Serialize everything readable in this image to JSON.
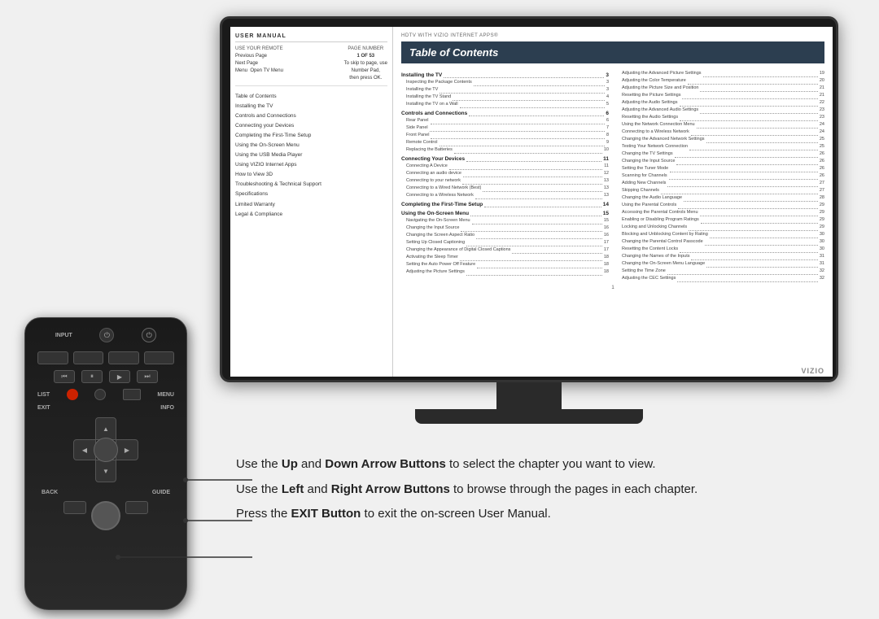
{
  "tv": {
    "brand": "VIZIO",
    "header_right": "HDTV WITH VIZIO INTERNET APPS®"
  },
  "manual": {
    "title": "USER MANUAL",
    "nav": {
      "col1_header": "USE YOUR REMOTE",
      "col2_header": "PAGE NUMBER",
      "rows": [
        {
          "action": "Previous Page",
          "detail": "1 OF 53"
        },
        {
          "action": "Next Page",
          "detail": "To skip to page, use"
        },
        {
          "action": "Menu  Open TV Menu",
          "detail": "Number Pad,"
        },
        {
          "action": "",
          "detail": "then press OK."
        }
      ],
      "page_display": "1 OF 53"
    },
    "toc_items": [
      "Table of Contents",
      "Installing the TV",
      "Controls and Connections",
      "Connecting your Devices",
      "Completing the First-Time Setup",
      "Using the On-Screen Menu",
      "Using the USB Media Player",
      "Using VIZIO Internet Apps",
      "How to View 3D",
      "Troubleshooting & Technical Support",
      "Specifications",
      "Limited Warranty",
      "Legal & Compliance"
    ],
    "toc_title": "Table of Contents",
    "toc_left_col": [
      {
        "title": "Installing the TV",
        "page": "3",
        "sub": [
          {
            "name": "Inspecting the Package Contents",
            "page": "3"
          },
          {
            "name": "Installing the TV",
            "page": "3"
          },
          {
            "name": "Installing the TV Stand",
            "page": "4"
          },
          {
            "name": "Installing the TV on a Wall",
            "page": "5"
          }
        ]
      },
      {
        "title": "Controls and Connections",
        "page": "6",
        "sub": [
          {
            "name": "Rear Panel",
            "page": "6"
          },
          {
            "name": "Side Panel",
            "page": "7"
          },
          {
            "name": "Front Panel",
            "page": "8"
          },
          {
            "name": "Remote Control",
            "page": "9"
          },
          {
            "name": "Replacing the Batteries",
            "page": "10"
          }
        ]
      },
      {
        "title": "Connecting Your Devices",
        "page": "11",
        "sub": [
          {
            "name": "Connecting A Device",
            "page": "11"
          },
          {
            "name": "Connecting an audio device",
            "page": "12"
          },
          {
            "name": "Connecting to your network",
            "page": "13"
          },
          {
            "name": "Connecting to a Wired Network (Best)",
            "page": "13"
          },
          {
            "name": "Connecting to a Wireless Network",
            "page": "13"
          }
        ]
      },
      {
        "title": "Completing the First-Time Setup",
        "page": "14",
        "sub": []
      },
      {
        "title": "Using the On-Screen Menu",
        "page": "15",
        "sub": [
          {
            "name": "Navigating the On-Screen Menu",
            "page": "15"
          },
          {
            "name": "Changing the Input Source",
            "page": "16"
          },
          {
            "name": "Changing the Screen Aspect Ratio",
            "page": "16"
          },
          {
            "name": "Setting Up Closed Captioning",
            "page": "17"
          },
          {
            "name": "Changing the Appearance of Digital Closed Captions",
            "page": "17"
          },
          {
            "name": "Activating the Sleep Timer",
            "page": "18"
          },
          {
            "name": "Setting the Auto Power Off Feature",
            "page": "18"
          },
          {
            "name": "Adjusting the Picture Settings",
            "page": "18"
          }
        ]
      }
    ],
    "toc_right_col": [
      {
        "name": "Adjusting the Advanced Picture Settings",
        "page": "19"
      },
      {
        "name": "Adjusting the Color Temperature",
        "page": "20"
      },
      {
        "name": "Adjusting the Picture Size and Position",
        "page": "21"
      },
      {
        "name": "Resetting the Picture Settings",
        "page": "21"
      },
      {
        "name": "Adjusting the Audio Settings",
        "page": "22"
      },
      {
        "name": "Adjusting the Advanced Audio Settings",
        "page": "23"
      },
      {
        "name": "Resetting the Audio Settings",
        "page": "23"
      },
      {
        "name": "Using the Network Connection Menu",
        "page": "24"
      },
      {
        "name": "Connecting to a Wireless Network",
        "page": "24"
      },
      {
        "name": "Changing the Advanced Network Settings",
        "page": "25"
      },
      {
        "name": "Testing Your Network Connection",
        "page": "25"
      },
      {
        "name": "Changing the TV Settings",
        "page": "26"
      },
      {
        "name": "Changing the Input Source",
        "page": "26"
      },
      {
        "name": "Setting the Tuner Mode",
        "page": "26"
      },
      {
        "name": "Scanning for Channels",
        "page": "26"
      },
      {
        "name": "Adding New Channels",
        "page": "27"
      },
      {
        "name": "Skipping Channels",
        "page": "27"
      },
      {
        "name": "Changing the Audio Language",
        "page": "28"
      },
      {
        "name": "Using the Parental Controls",
        "page": "29"
      },
      {
        "name": "Accessing the Parental Controls Menu",
        "page": "29"
      },
      {
        "name": "Enabling or Disabling Program Ratings",
        "page": "29"
      },
      {
        "name": "Locking and Unlocking Channels",
        "page": "29"
      },
      {
        "name": "Blocking and Unblocking Content by Rating",
        "page": "30"
      },
      {
        "name": "Changing the Parental Control Passcode",
        "page": "30"
      },
      {
        "name": "Resetting the Content Locks",
        "page": "30"
      },
      {
        "name": "Changing the Names of the Inputs",
        "page": "31"
      },
      {
        "name": "Changing the On-Screen Menu Language",
        "page": "31"
      },
      {
        "name": "Setting the Time Zone",
        "page": "32"
      },
      {
        "name": "Adjusting the CEC Settings",
        "page": "32"
      }
    ]
  },
  "remote": {
    "labels": {
      "input": "INPUT",
      "exit": "EXIT",
      "info": "INFO",
      "list": "LIST",
      "menu": "MENU",
      "back": "BACK",
      "guide": "GUIDE"
    }
  },
  "instructions": [
    {
      "text": "Use the Up and Down Arrow Buttons to select the chapter you want to view.",
      "bold_parts": [
        "Up",
        "Down Arrow Buttons"
      ]
    },
    {
      "text": "Use the Left and Right Arrow Buttons to browse through the pages in each chapter.",
      "bold_parts": [
        "Left",
        "Right Arrow Buttons"
      ]
    },
    {
      "text": "Press the EXIT Button to exit the on-screen User Manual.",
      "bold_parts": [
        "EXIT Button"
      ]
    }
  ]
}
